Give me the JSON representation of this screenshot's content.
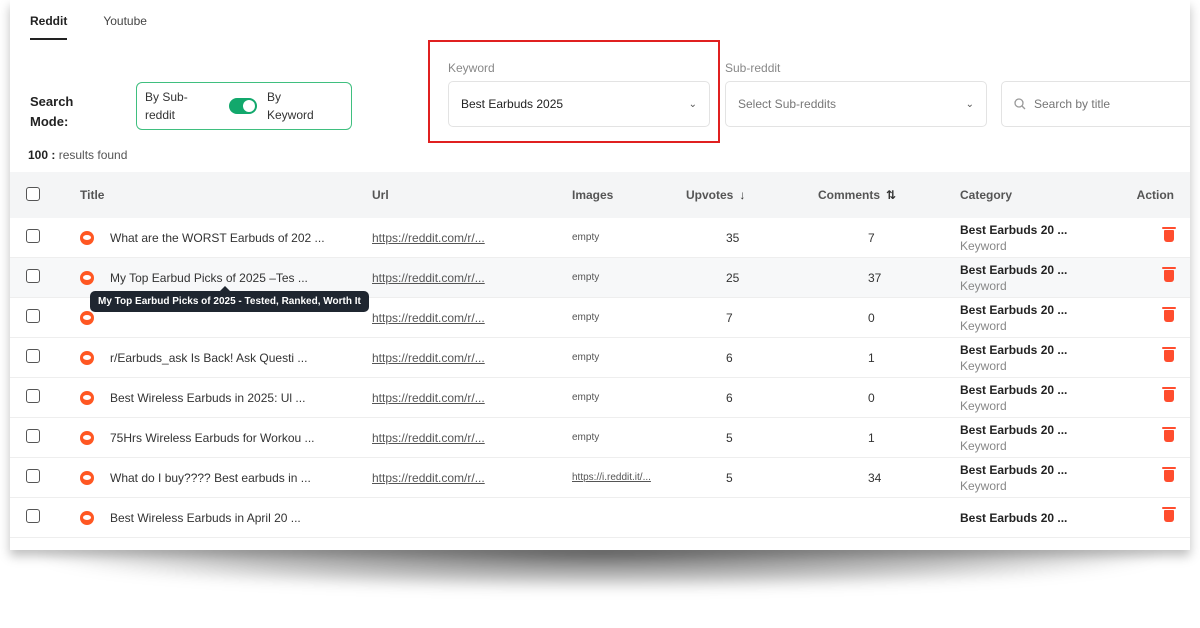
{
  "tabs": [
    {
      "label": "Reddit",
      "active": true
    },
    {
      "label": "Youtube",
      "active": false
    }
  ],
  "search_mode": {
    "label": "Search Mode:",
    "left_option": "By Sub-reddit",
    "right_option": "By Keyword",
    "toggle_on": true
  },
  "keyword": {
    "label": "Keyword",
    "value": "Best Earbuds 2025"
  },
  "subreddit": {
    "label": "Sub-reddit",
    "placeholder": "Select Sub-reddits"
  },
  "search": {
    "placeholder": "Search by title"
  },
  "results": {
    "count": "100 :",
    "text": " results found"
  },
  "table": {
    "headers": {
      "title": "Title",
      "url": "Url",
      "images": "Images",
      "upvotes": "Upvotes",
      "comments": "Comments",
      "category": "Category",
      "action": "Action"
    },
    "rows": [
      {
        "title": "What are the WORST Earbuds of 202 ...",
        "url": "https://reddit.com/r/...",
        "images": "empty",
        "upvotes": "35",
        "comments": "7",
        "category": "Best Earbuds 20 ...",
        "category_type": "Keyword"
      },
      {
        "title": "My Top Earbud Picks of 2025 –Tes ...",
        "url": "https://reddit.com/r/...",
        "images": "empty",
        "upvotes": "25",
        "comments": "37",
        "category": "Best Earbuds 20 ...",
        "category_type": "Keyword"
      },
      {
        "title": "",
        "url": "https://reddit.com/r/...",
        "images": "empty",
        "upvotes": "7",
        "comments": "0",
        "category": "Best Earbuds 20 ...",
        "category_type": "Keyword"
      },
      {
        "title": "r/Earbuds_ask Is Back! Ask Questi ...",
        "url": "https://reddit.com/r/...",
        "images": "empty",
        "upvotes": "6",
        "comments": "1",
        "category": "Best Earbuds 20 ...",
        "category_type": "Keyword"
      },
      {
        "title": "Best Wireless Earbuds in 2025: Ul ...",
        "url": "https://reddit.com/r/...",
        "images": "empty",
        "upvotes": "6",
        "comments": "0",
        "category": "Best Earbuds 20 ...",
        "category_type": "Keyword"
      },
      {
        "title": "75Hrs Wireless Earbuds for Workou ...",
        "url": "https://reddit.com/r/...",
        "images": "empty",
        "upvotes": "5",
        "comments": "1",
        "category": "Best Earbuds 20 ...",
        "category_type": "Keyword"
      },
      {
        "title": "What do I buy???? Best earbuds in ...",
        "url": "https://reddit.com/r/...",
        "images": "https://i.reddit.it/...",
        "upvotes": "5",
        "comments": "34",
        "category": "Best Earbuds 20 ...",
        "category_type": "Keyword"
      },
      {
        "title": "Best Wireless Earbuds in April 20 ...",
        "url": "",
        "images": "",
        "upvotes": "",
        "comments": "",
        "category": "Best Earbuds 20 ...",
        "category_type": ""
      }
    ]
  },
  "tooltip": {
    "text": "My Top Earbud Picks of 2025 - Tested, Ranked, Worth It"
  },
  "colors": {
    "accent_green": "#12a86c",
    "highlight_red": "#e02020",
    "reddit_orange": "#ff5722",
    "delete_red": "#ff4d2e"
  }
}
